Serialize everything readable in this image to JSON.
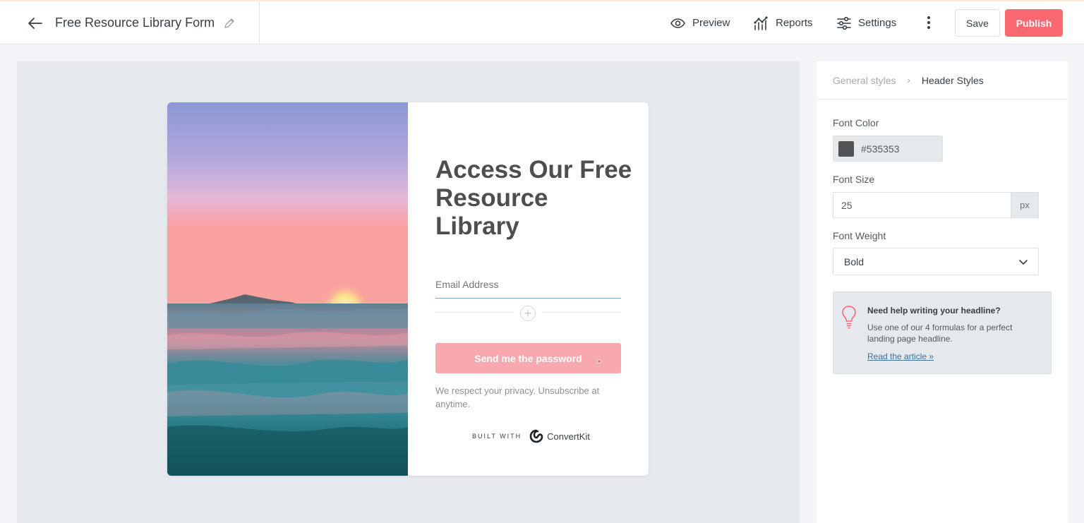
{
  "topbar": {
    "title": "Free Resource Library Form",
    "back_icon": "arrow-left-icon",
    "edit_icon": "pencil-icon",
    "nav": [
      {
        "label": "Preview",
        "icon": "eye-icon"
      },
      {
        "label": "Reports",
        "icon": "chart-icon"
      },
      {
        "label": "Settings",
        "icon": "sliders-icon"
      }
    ],
    "more_icon": "kebab-menu-icon",
    "save_label": "Save",
    "publish_label": "Publish"
  },
  "form": {
    "headline": "Access Our Free Resource Library",
    "email_placeholder": "Email Address",
    "submit_label": "Send me the password",
    "privacy_text": "We respect your privacy. Unsubscribe at anytime.",
    "built_with_label": "BUILT WITH",
    "brand_name": "ConvertKit"
  },
  "panel": {
    "breadcrumb_parent": "General styles",
    "breadcrumb_current": "Header Styles",
    "font_color_label": "Font Color",
    "font_color_value": "#535353",
    "font_size_label": "Font Size",
    "font_size_value": "25",
    "font_size_unit": "px",
    "font_weight_label": "Font Weight",
    "font_weight_value": "Bold",
    "help": {
      "title": "Need help writing your headline?",
      "text": "Use one of our 4 formulas for a perfect landing page headline.",
      "link": "Read the article »"
    }
  },
  "colors": {
    "accent": "#fb6970",
    "button_light": "#f7a9ad",
    "headline": "#4e4e4e",
    "canvas": "#e5e9ed"
  }
}
